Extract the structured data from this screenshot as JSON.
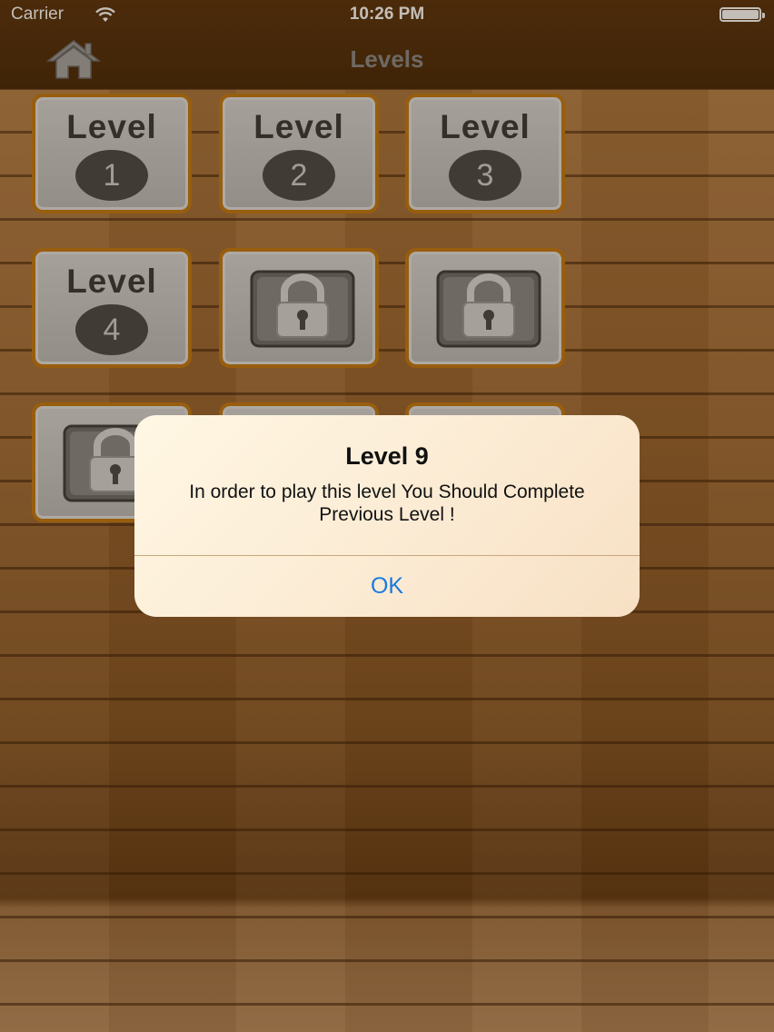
{
  "status_bar": {
    "carrier": "Carrier",
    "time": "10:26 PM"
  },
  "nav": {
    "title": "Levels",
    "home_icon": "home-icon"
  },
  "levels": [
    {
      "label": "Level",
      "number": "1",
      "locked": false
    },
    {
      "label": "Level",
      "number": "2",
      "locked": false
    },
    {
      "label": "Level",
      "number": "3",
      "locked": false
    },
    {
      "label": "Level",
      "number": "4",
      "locked": false
    },
    {
      "locked": true,
      "icon": "lock-icon"
    },
    {
      "locked": true,
      "icon": "lock-icon"
    },
    {
      "locked": true,
      "icon": "lock-icon"
    },
    {
      "locked": true,
      "icon": "lock-icon"
    },
    {
      "locked": true,
      "icon": "lock-icon"
    }
  ],
  "alert": {
    "title": "Level 9",
    "message": "In order to play this level You Should Complete Previous Level !",
    "ok_label": "OK"
  },
  "colors": {
    "tile_border": "#c47a14",
    "alert_button": "#1a7ae0",
    "top_bar": "#4a2a0a"
  }
}
